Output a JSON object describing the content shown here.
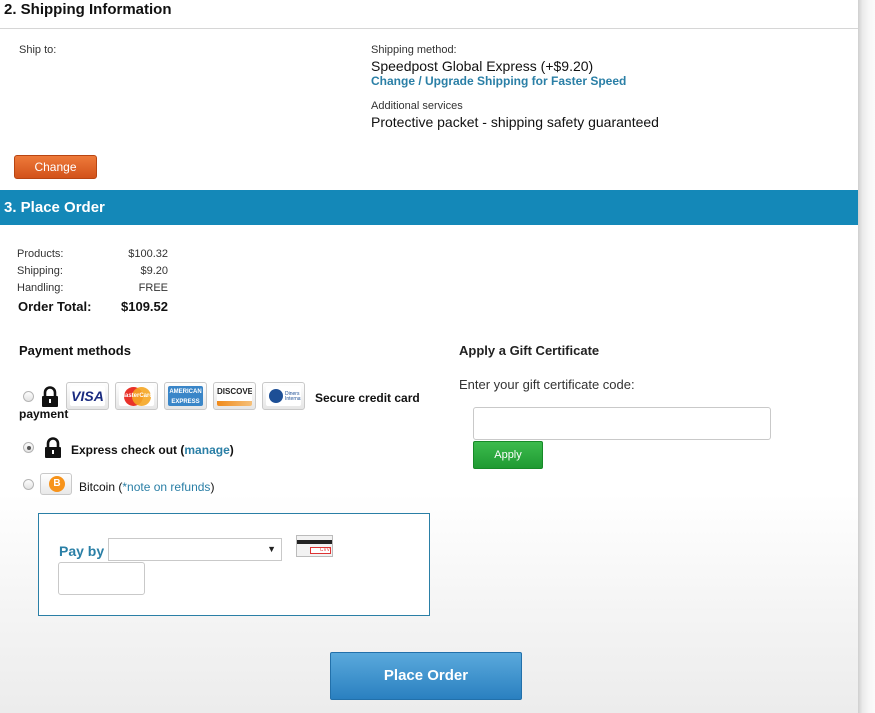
{
  "shipping": {
    "header": "2. Shipping Information",
    "ship_to_label": "Ship to:",
    "method_label": "Shipping method:",
    "method_value": "Speedpost Global Express (+$9.20)",
    "upgrade_link": "Change / Upgrade Shipping for Faster Speed",
    "additional_label": "Additional services",
    "additional_value": "Protective packet - shipping safety guaranteed",
    "change_button": "Change"
  },
  "order": {
    "header": "3. Place Order",
    "totals": [
      {
        "label": "Products:",
        "value": "$100.32"
      },
      {
        "label": "Shipping:",
        "value": "$9.20"
      },
      {
        "label": "Handling:",
        "value": "FREE"
      }
    ],
    "total_label": "Order Total:",
    "total_value": "$109.52"
  },
  "payment": {
    "title": "Payment methods",
    "cards": [
      "VISA",
      "MasterCard",
      "AMERICAN EXPRESS",
      "DISCOVER",
      "Diners Club International"
    ],
    "secure_text_1": "Secure credit card",
    "secure_text_2": "payment",
    "express_text": "Express check out (",
    "express_link": "manage",
    "express_close": ")",
    "bitcoin_text": "Bitcoin (",
    "bitcoin_link": "*note on refunds",
    "bitcoin_close": ")",
    "pay_by_label": "Pay by",
    "selected_method": "express",
    "cvv_label": "CVV"
  },
  "gift": {
    "title": "Apply a Gift Certificate",
    "prompt": "Enter your gift certificate code:",
    "input_value": "",
    "apply_button": "Apply"
  },
  "place_order_button": "Place Order",
  "colors": {
    "bar_blue": "#1488b8",
    "link_blue": "#2a7fa6",
    "change_orange": "#e06428",
    "apply_green": "#2aa83d"
  }
}
